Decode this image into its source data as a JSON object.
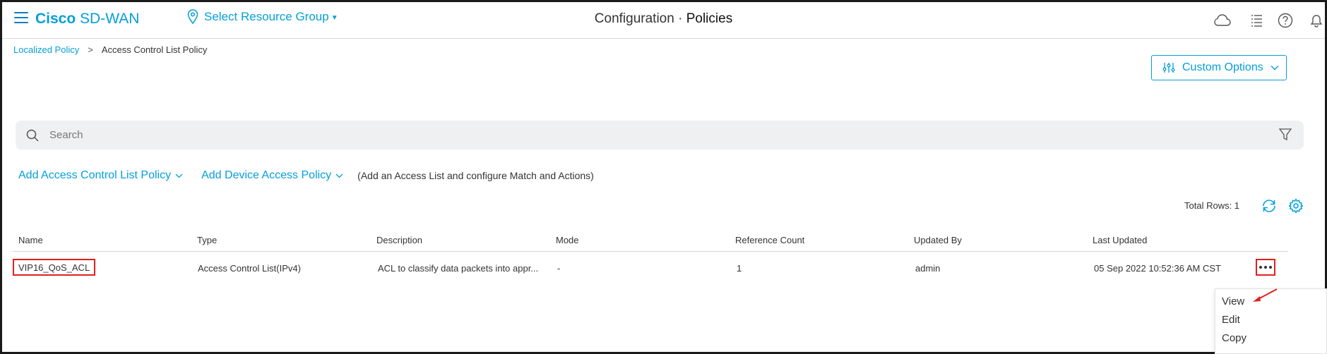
{
  "header": {
    "brand_bold": "Cisco",
    "brand_rest": "SD-WAN",
    "resource_group": "Select Resource Group",
    "title_part1": "Configuration",
    "title_sep": "·",
    "title_part2": "Policies",
    "icons": [
      "menu-icon",
      "location-pin-icon",
      "cloud-icon",
      "list-icon",
      "help-icon",
      "bell-icon"
    ]
  },
  "breadcrumb": {
    "parent": "Localized Policy",
    "separator": ">",
    "current": "Access Control List Policy"
  },
  "custom_options": {
    "label": "Custom Options"
  },
  "search": {
    "placeholder": "Search"
  },
  "actions": {
    "add_acl": "Add Access Control List Policy",
    "add_device_access": "Add Device Access Policy",
    "hint": "(Add an Access List and configure Match and Actions)"
  },
  "table": {
    "total_rows_label": "Total Rows: 1",
    "columns": [
      "Name",
      "Type",
      "Description",
      "Mode",
      "Reference Count",
      "Updated By",
      "Last Updated"
    ],
    "rows": [
      {
        "name": "VIP16_QoS_ACL",
        "type": "Access Control List(IPv4)",
        "description": "ACL to classify data packets into appr...",
        "mode": "-",
        "reference_count": "1",
        "updated_by": "admin",
        "last_updated": "05 Sep 2022 10:52:36 AM CST"
      }
    ]
  },
  "context_menu": {
    "items": [
      "View",
      "Edit",
      "Copy"
    ]
  },
  "colors": {
    "accent": "#049fd9",
    "highlight": "#e02020",
    "search_bg": "#eff0f2"
  }
}
